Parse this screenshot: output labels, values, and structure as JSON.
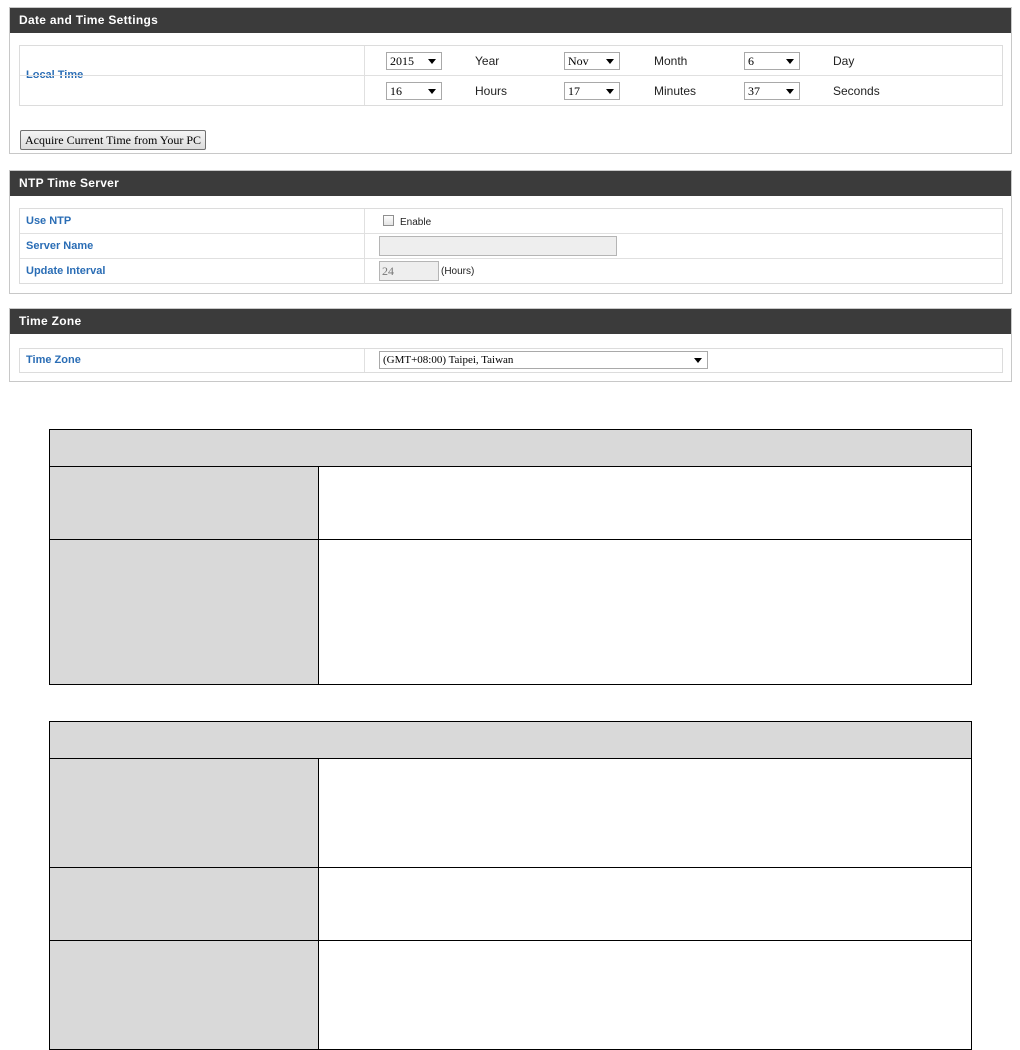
{
  "date_time_settings": {
    "title": "Date and Time Settings",
    "local_time_label": "Local Time",
    "year_value": "2015",
    "year_unit": "Year",
    "month_value": "Nov",
    "month_unit": "Month",
    "day_value": "6",
    "day_unit": "Day",
    "hour_value": "16",
    "hour_unit": "Hours",
    "minute_value": "17",
    "minute_unit": "Minutes",
    "second_value": "37",
    "second_unit": "Seconds",
    "acquire_button": "Acquire Current Time from Your PC"
  },
  "ntp_time_server": {
    "title": "NTP Time Server",
    "use_ntp_label": "Use NTP",
    "enable_label": "Enable",
    "enable_checked": false,
    "server_name_label": "Server Name",
    "server_name_value": "",
    "update_interval_label": "Update Interval",
    "update_interval_value": "24",
    "update_interval_unit": "(Hours)"
  },
  "time_zone": {
    "title": "Time Zone",
    "time_zone_label": "Time Zone",
    "time_zone_value": "(GMT+08:00) Taipei, Taiwan"
  },
  "colors": {
    "panel_header_bg": "#3b3b3b",
    "label_blue": "#2a6db5",
    "doc_table_gray": "#d9d9d9"
  }
}
